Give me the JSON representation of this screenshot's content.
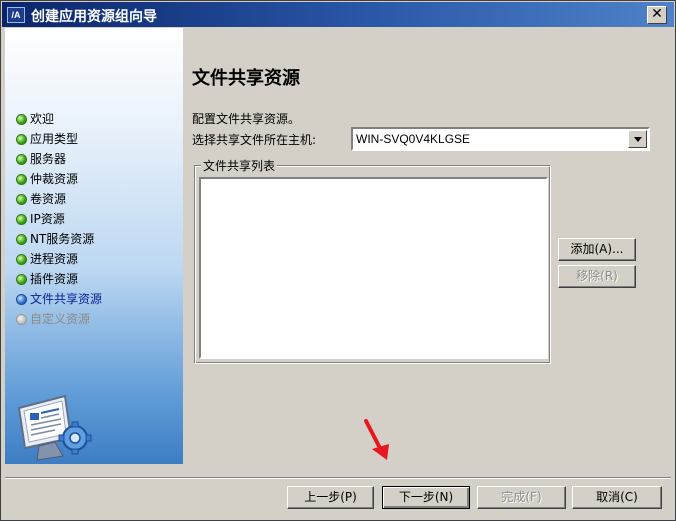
{
  "window": {
    "title": "创建应用资源组向导",
    "logo_text": "/A",
    "close_label": "✕"
  },
  "sidebar": {
    "items": [
      {
        "label": "欢迎",
        "state": "done"
      },
      {
        "label": "应用类型",
        "state": "done"
      },
      {
        "label": "服务器",
        "state": "done"
      },
      {
        "label": "仲裁资源",
        "state": "done"
      },
      {
        "label": "卷资源",
        "state": "done"
      },
      {
        "label": "IP资源",
        "state": "done"
      },
      {
        "label": "NT服务资源",
        "state": "done"
      },
      {
        "label": "进程资源",
        "state": "done"
      },
      {
        "label": "插件资源",
        "state": "done"
      },
      {
        "label": "文件共享资源",
        "state": "current"
      },
      {
        "label": "自定义资源",
        "state": "pending"
      }
    ],
    "image_icon": "monitor-gear-icon"
  },
  "page": {
    "title": "文件共享资源",
    "description": "配置文件共享资源。",
    "host_label": "选择共享文件所在主机:",
    "host_value": "WIN-SVQ0V4KLGSE",
    "group_label": "文件共享列表",
    "list_items": []
  },
  "side_buttons": {
    "add": "添加(A)...",
    "remove": "移除(R)"
  },
  "footer": {
    "prev": "上一步(P)",
    "next": "下一步(N)",
    "finish": "完成(F)",
    "cancel": "取消(C)"
  },
  "colors": {
    "title_bar": "#0a246a",
    "dialog_bg": "#d4d0c8",
    "step_done": "#3aa012",
    "step_current": "#2e6fd0",
    "step_pending": "#bdbdbd",
    "annotation_arrow": "#e8161e"
  }
}
